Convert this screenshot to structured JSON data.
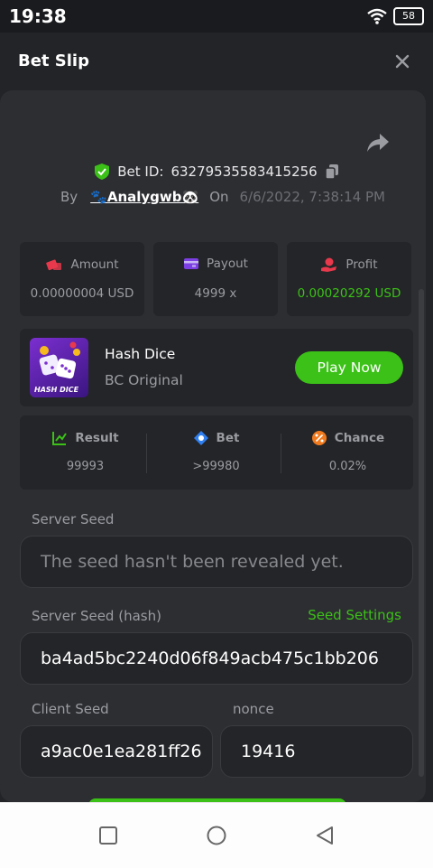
{
  "status_bar": {
    "time": "19:38",
    "battery": "58"
  },
  "header": {
    "title": "Bet Slip"
  },
  "bet": {
    "id_label": "Bet ID:",
    "id_value": "63279535583415256",
    "by_label": "By",
    "username": "🐾Analygwb🐼",
    "on_label": "On",
    "date": "6/6/2022, 7:38:14 PM"
  },
  "stats": [
    {
      "label": "Amount",
      "value": "0.00000004 USD"
    },
    {
      "label": "Payout",
      "value": "4999 x"
    },
    {
      "label": "Profit",
      "value": "0.00020292 USD"
    }
  ],
  "game": {
    "name": "Hash Dice",
    "subtitle": "BC Original",
    "thumb_text": "HASH DICE",
    "play_label": "Play Now"
  },
  "results": [
    {
      "label": "Result",
      "value": "99993"
    },
    {
      "label": "Bet",
      "value": ">99980"
    },
    {
      "label": "Chance",
      "value": "0.02%"
    }
  ],
  "seeds": {
    "server_seed_label": "Server Seed",
    "server_seed_placeholder": "The seed hasn't been revealed yet.",
    "server_hash_label": "Server Seed (hash)",
    "seed_settings_label": "Seed Settings",
    "server_hash_value": "ba4ad5bc2240d06f849acb475c1bb206",
    "client_seed_label": "Client Seed",
    "client_seed_value": "a9ac0e1ea281ff26",
    "nonce_label": "nonce",
    "nonce_value": "19416"
  },
  "colors": {
    "accent_green": "#3bc117",
    "panel": "#2d2e32",
    "card": "#242528",
    "muted_text": "#9a9ca2"
  }
}
